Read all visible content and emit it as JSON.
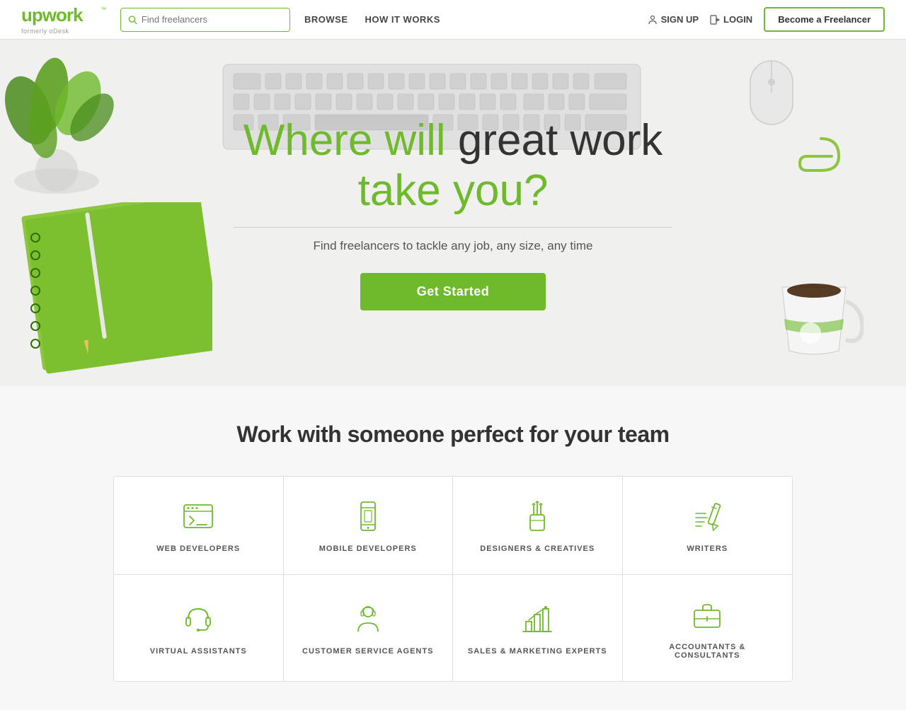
{
  "header": {
    "logo": {
      "brand": "upwork",
      "tm": "™",
      "sub": "formerly oDesk"
    },
    "search": {
      "placeholder": "Find freelancers"
    },
    "nav": [
      {
        "label": "BROWSE",
        "id": "browse"
      },
      {
        "label": "HOW IT WORKS",
        "id": "how-it-works"
      }
    ],
    "actions": {
      "signup_label": "SIGN UP",
      "login_label": "LOGIN",
      "become_label": "Become a Freelancer"
    }
  },
  "hero": {
    "title_part1": "Where will ",
    "title_part2": "great work",
    "title_part3": "take you?",
    "subtitle": "Find freelancers to tackle any job, any size, any time",
    "cta_label": "Get Started"
  },
  "main": {
    "section_title": "Work with someone perfect for your team",
    "categories": [
      {
        "id": "web-developers",
        "label": "WEB DEVELOPERS",
        "icon": "browser-code"
      },
      {
        "id": "mobile-developers",
        "label": "MOBILE DEVELOPERS",
        "icon": "mobile-phone"
      },
      {
        "id": "designers-creatives",
        "label": "DESIGNERS & CREATIVES",
        "icon": "paint-cup"
      },
      {
        "id": "writers",
        "label": "WRITERS",
        "icon": "pencil"
      },
      {
        "id": "virtual-assistants",
        "label": "VIRTUAL ASSISTANTS",
        "icon": "headset"
      },
      {
        "id": "customer-service-agents",
        "label": "CUSTOMER SERVICE AGENTS",
        "icon": "person-headset"
      },
      {
        "id": "sales-marketing-experts",
        "label": "SALES & MARKETING EXPERTS",
        "icon": "bar-chart"
      },
      {
        "id": "accountants-consultants",
        "label": "ACCOUNTANTS & CONSULTANTS",
        "icon": "briefcase"
      }
    ]
  },
  "colors": {
    "green": "#6fba2c",
    "dark": "#333333",
    "gray": "#555555"
  }
}
